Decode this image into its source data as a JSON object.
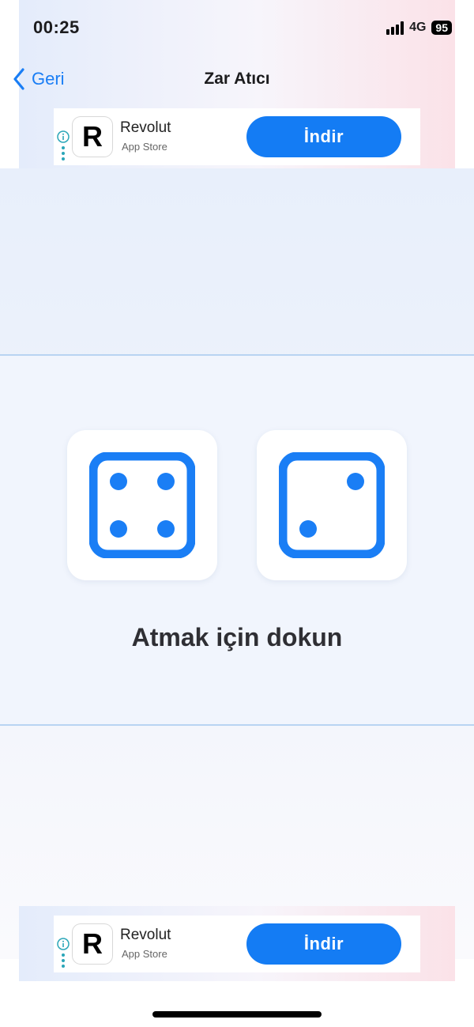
{
  "status": {
    "time": "00:25",
    "network": "4G",
    "battery": "95"
  },
  "nav": {
    "back_label": "Geri",
    "title": "Zar Atıcı"
  },
  "ads": [
    {
      "app_name": "Revolut",
      "store": "App Store",
      "button": "İndir",
      "icon_letter": "R"
    },
    {
      "app_name": "Revolut",
      "store": "App Store",
      "button": "İndir",
      "icon_letter": "R"
    }
  ],
  "dice": [
    {
      "value": 4,
      "color": "#1a7ef5"
    },
    {
      "value": 2,
      "color": "#1a7ef5"
    }
  ],
  "hint": "Atmak için dokun",
  "colors": {
    "accent": "#1a7ef5",
    "install_button": "#147cf4"
  }
}
